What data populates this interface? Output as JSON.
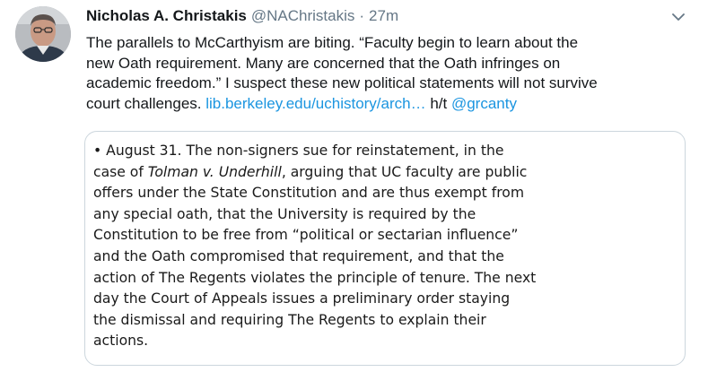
{
  "tweet": {
    "display_name": "Nicholas A. Christakis",
    "handle": "@NAChristakis",
    "separator": "·",
    "time": "27m",
    "text_lines": [
      "The parallels to McCarthyism are biting. “Faculty begin to learn about the",
      "new Oath requirement. Many are concerned that the Oath infringes on",
      "academic freedom.” I suspect these new political statements will not survive"
    ],
    "last_line_prefix": "court challenges. ",
    "link_text": "lib.berkeley.edu/uchistory/arch…",
    "ht_text": " h/t ",
    "mention": "@grcanty",
    "caret_icon": "chevron-down-icon"
  },
  "card": {
    "lines": [
      {
        "segments": [
          "• August 31. The non-signers sue for reinstatement, in the"
        ]
      },
      {
        "segments": [
          "case of ",
          "Tolman v. Underhill",
          ", arguing that UC faculty are public"
        ]
      },
      {
        "segments": [
          "offers under the State Constitution and are thus exempt from"
        ]
      },
      {
        "segments": [
          "any special oath, that the University is required by the"
        ]
      },
      {
        "segments": [
          "Constitution to be free from “political or sectarian influence”"
        ]
      },
      {
        "segments": [
          "and the Oath compromised that requirement, and that the"
        ]
      },
      {
        "segments": [
          "action of The Regents violates the principle of tenure. The next"
        ]
      },
      {
        "segments": [
          "day the Court of Appeals issues a preliminary order staying"
        ]
      },
      {
        "segments": [
          "the dismissal and requiring The Regents to explain their"
        ]
      },
      {
        "segments": [
          "actions."
        ]
      }
    ]
  },
  "colors": {
    "text": "#14171a",
    "secondary": "#657786",
    "link": "#1b95e0",
    "card_border": "#ccd6dd"
  }
}
